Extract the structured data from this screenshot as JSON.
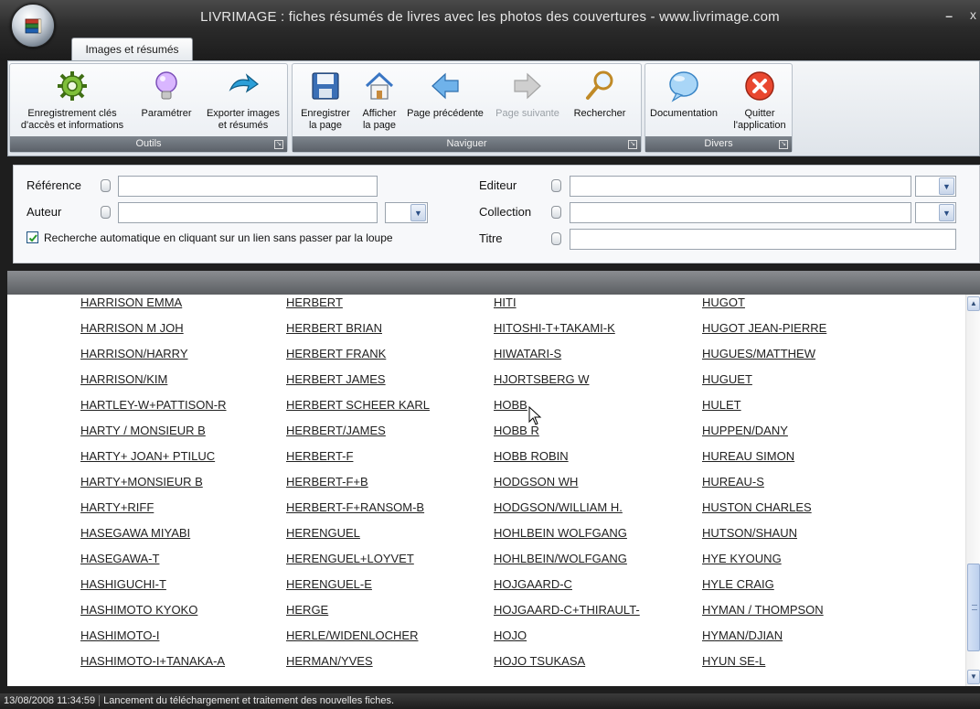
{
  "window": {
    "title": "LIVRIMAGE : fiches résumés de livres avec les photos des couvertures  - www.livrimage.com",
    "minimize": "–",
    "close": "x"
  },
  "tabs": [
    {
      "label": "Images et résumés"
    }
  ],
  "ribbon": {
    "outils": {
      "label": "Outils",
      "buttons": [
        {
          "line1": "Enregistrement clés",
          "line2": "d'accès et informations",
          "icon": "gears-icon"
        },
        {
          "line1": "Paramétrer",
          "line2": "",
          "icon": "lightbulb-icon"
        },
        {
          "line1": "Exporter images",
          "line2": "et résumés",
          "icon": "export-arrow-icon"
        }
      ]
    },
    "naviguer": {
      "label": "Naviguer",
      "buttons": [
        {
          "line1": "Enregistrer",
          "line2": "la page",
          "icon": "floppy-disk-icon"
        },
        {
          "line1": "Afficher",
          "line2": "la page",
          "icon": "home-icon"
        },
        {
          "line1": "Page précédente",
          "line2": "",
          "icon": "arrow-left-icon"
        },
        {
          "line1": "Page suivante",
          "line2": "",
          "icon": "arrow-right-icon"
        },
        {
          "line1": "Rechercher",
          "line2": "",
          "icon": "magnifier-icon"
        }
      ]
    },
    "divers": {
      "label": "Divers",
      "buttons": [
        {
          "line1": "Documentation",
          "line2": "",
          "icon": "speech-bubble-icon"
        },
        {
          "line1": "Quitter",
          "line2": "l'application",
          "icon": "close-circle-icon"
        }
      ]
    }
  },
  "search": {
    "reference_label": "Référence",
    "auteur_label": "Auteur",
    "editeur_label": "Editeur",
    "collection_label": "Collection",
    "titre_label": "Titre",
    "auto_search_label": "Recherche automatique en cliquant sur un lien sans passer par la loupe",
    "auto_search_checked": true
  },
  "names": {
    "col1": [
      "HARRISON EMMA",
      "HARRISON M JOH",
      "HARRISON/HARRY",
      "HARRISON/KIM",
      "HARTLEY-W+PATTISON-R",
      "HARTY / MONSIEUR B",
      "HARTY+ JOAN+ PTILUC",
      "HARTY+MONSIEUR B",
      "HARTY+RIFF",
      "HASEGAWA MIYABI",
      "HASEGAWA-T",
      "HASHIGUCHI-T",
      "HASHIMOTO KYOKO",
      "HASHIMOTO-I",
      "HASHIMOTO-I+TANAKA-A"
    ],
    "col2": [
      "HERBERT",
      "HERBERT BRIAN",
      "HERBERT FRANK",
      "HERBERT JAMES",
      "HERBERT SCHEER KARL",
      "HERBERT/JAMES",
      "HERBERT-F",
      "HERBERT-F+B",
      "HERBERT-F+RANSOM-B",
      "HERENGUEL",
      "HERENGUEL+LOYVET",
      "HERENGUEL-E",
      "HERGE",
      "HERLE/WIDENLOCHER",
      "HERMAN/YVES"
    ],
    "col3": [
      "HITI",
      "HITOSHI-T+TAKAMI-K",
      "HIWATARI-S",
      "HJORTSBERG W",
      "HOBB",
      "HOBB R",
      "HOBB ROBIN",
      "HODGSON WH",
      "HODGSON/WILLIAM H.",
      "HOHLBEIN WOLFGANG",
      "HOHLBEIN/WOLFGANG",
      "HOJGAARD-C",
      "HOJGAARD-C+THIRAULT-",
      "HOJO",
      "HOJO TSUKASA"
    ],
    "col4": [
      "HUGOT",
      "HUGOT JEAN-PIERRE",
      "HUGUES/MATTHEW",
      "HUGUET",
      "HULET",
      "HUPPEN/DANY",
      "HUREAU SIMON",
      "HUREAU-S",
      "HUSTON CHARLES",
      "HUTSON/SHAUN",
      "HYE KYOUNG",
      "HYLE CRAIG",
      "HYMAN / THOMPSON",
      "HYMAN/DJIAN",
      "HYUN SE-L"
    ]
  },
  "status": {
    "timestamp": "13/08/2008 11:34:59",
    "message": "Lancement du téléchargement et traitement des nouvelles fiches."
  }
}
